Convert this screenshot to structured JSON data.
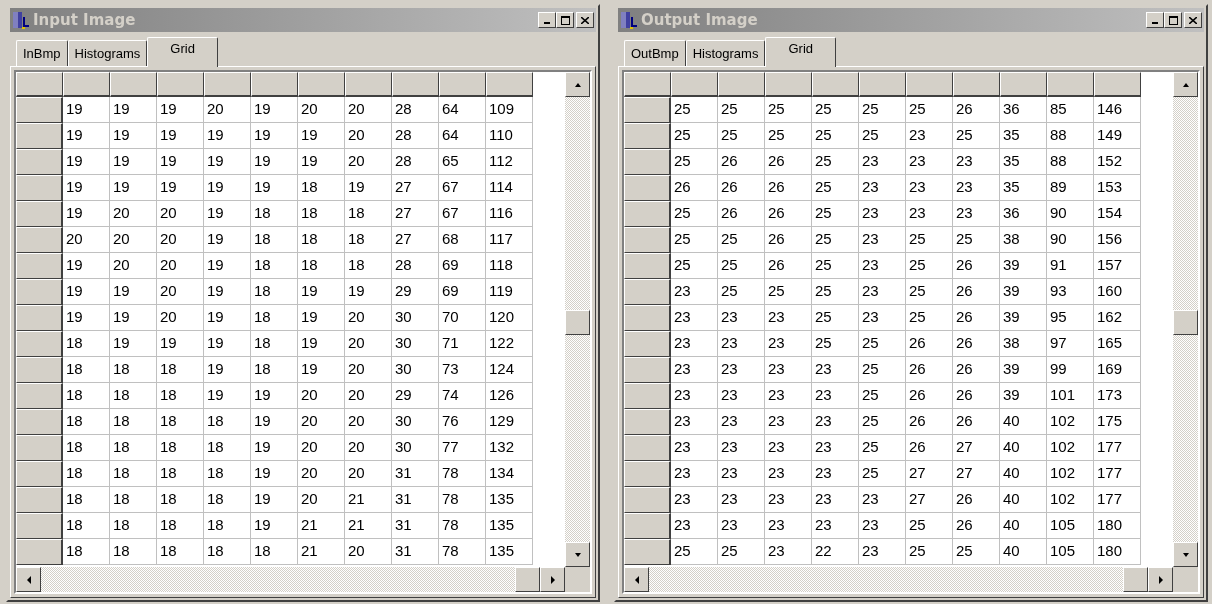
{
  "windows": [
    {
      "title": "Input Image",
      "tabs": [
        {
          "label": "InBmp",
          "selected": false
        },
        {
          "label": "Histograms",
          "selected": false
        },
        {
          "label": "Grid",
          "selected": true
        }
      ],
      "rows": [
        [
          "19",
          "19",
          "19",
          "20",
          "19",
          "20",
          "20",
          "28",
          "64",
          "109"
        ],
        [
          "19",
          "19",
          "19",
          "19",
          "19",
          "19",
          "20",
          "28",
          "64",
          "110"
        ],
        [
          "19",
          "19",
          "19",
          "19",
          "19",
          "19",
          "20",
          "28",
          "65",
          "112"
        ],
        [
          "19",
          "19",
          "19",
          "19",
          "19",
          "18",
          "19",
          "27",
          "67",
          "114"
        ],
        [
          "19",
          "20",
          "20",
          "19",
          "18",
          "18",
          "18",
          "27",
          "67",
          "116"
        ],
        [
          "20",
          "20",
          "20",
          "19",
          "18",
          "18",
          "18",
          "27",
          "68",
          "117"
        ],
        [
          "19",
          "20",
          "20",
          "19",
          "18",
          "18",
          "18",
          "28",
          "69",
          "118"
        ],
        [
          "19",
          "19",
          "20",
          "19",
          "18",
          "19",
          "19",
          "29",
          "69",
          "119"
        ],
        [
          "19",
          "19",
          "20",
          "19",
          "18",
          "19",
          "20",
          "30",
          "70",
          "120"
        ],
        [
          "18",
          "19",
          "19",
          "19",
          "18",
          "19",
          "20",
          "30",
          "71",
          "122"
        ],
        [
          "18",
          "18",
          "18",
          "19",
          "18",
          "19",
          "20",
          "30",
          "73",
          "124"
        ],
        [
          "18",
          "18",
          "18",
          "19",
          "19",
          "20",
          "20",
          "29",
          "74",
          "126"
        ],
        [
          "18",
          "18",
          "18",
          "18",
          "19",
          "20",
          "20",
          "30",
          "76",
          "129"
        ],
        [
          "18",
          "18",
          "18",
          "18",
          "19",
          "20",
          "20",
          "30",
          "77",
          "132"
        ],
        [
          "18",
          "18",
          "18",
          "18",
          "19",
          "20",
          "20",
          "31",
          "78",
          "134"
        ],
        [
          "18",
          "18",
          "18",
          "18",
          "19",
          "20",
          "21",
          "31",
          "78",
          "135"
        ],
        [
          "18",
          "18",
          "18",
          "18",
          "19",
          "21",
          "21",
          "31",
          "78",
          "135"
        ],
        [
          "18",
          "18",
          "18",
          "18",
          "18",
          "21",
          "20",
          "31",
          "78",
          "135"
        ]
      ]
    },
    {
      "title": "Output Image",
      "tabs": [
        {
          "label": "OutBmp",
          "selected": false
        },
        {
          "label": "Histograms",
          "selected": false
        },
        {
          "label": "Grid",
          "selected": true
        }
      ],
      "rows": [
        [
          "25",
          "25",
          "25",
          "25",
          "25",
          "25",
          "26",
          "36",
          "85",
          "146"
        ],
        [
          "25",
          "25",
          "25",
          "25",
          "25",
          "23",
          "25",
          "35",
          "88",
          "149"
        ],
        [
          "25",
          "26",
          "26",
          "25",
          "23",
          "23",
          "23",
          "35",
          "88",
          "152"
        ],
        [
          "26",
          "26",
          "26",
          "25",
          "23",
          "23",
          "23",
          "35",
          "89",
          "153"
        ],
        [
          "25",
          "26",
          "26",
          "25",
          "23",
          "23",
          "23",
          "36",
          "90",
          "154"
        ],
        [
          "25",
          "25",
          "26",
          "25",
          "23",
          "25",
          "25",
          "38",
          "90",
          "156"
        ],
        [
          "25",
          "25",
          "26",
          "25",
          "23",
          "25",
          "26",
          "39",
          "91",
          "157"
        ],
        [
          "23",
          "25",
          "25",
          "25",
          "23",
          "25",
          "26",
          "39",
          "93",
          "160"
        ],
        [
          "23",
          "23",
          "23",
          "25",
          "23",
          "25",
          "26",
          "39",
          "95",
          "162"
        ],
        [
          "23",
          "23",
          "23",
          "25",
          "25",
          "26",
          "26",
          "38",
          "97",
          "165"
        ],
        [
          "23",
          "23",
          "23",
          "23",
          "25",
          "26",
          "26",
          "39",
          "99",
          "169"
        ],
        [
          "23",
          "23",
          "23",
          "23",
          "25",
          "26",
          "26",
          "39",
          "101",
          "173"
        ],
        [
          "23",
          "23",
          "23",
          "23",
          "25",
          "26",
          "26",
          "40",
          "102",
          "175"
        ],
        [
          "23",
          "23",
          "23",
          "23",
          "25",
          "26",
          "27",
          "40",
          "102",
          "177"
        ],
        [
          "23",
          "23",
          "23",
          "23",
          "25",
          "27",
          "27",
          "40",
          "102",
          "177"
        ],
        [
          "23",
          "23",
          "23",
          "23",
          "23",
          "27",
          "26",
          "40",
          "102",
          "177"
        ],
        [
          "23",
          "23",
          "23",
          "23",
          "23",
          "25",
          "26",
          "40",
          "105",
          "180"
        ],
        [
          "25",
          "25",
          "23",
          "22",
          "23",
          "25",
          "25",
          "40",
          "105",
          "180"
        ]
      ]
    }
  ]
}
